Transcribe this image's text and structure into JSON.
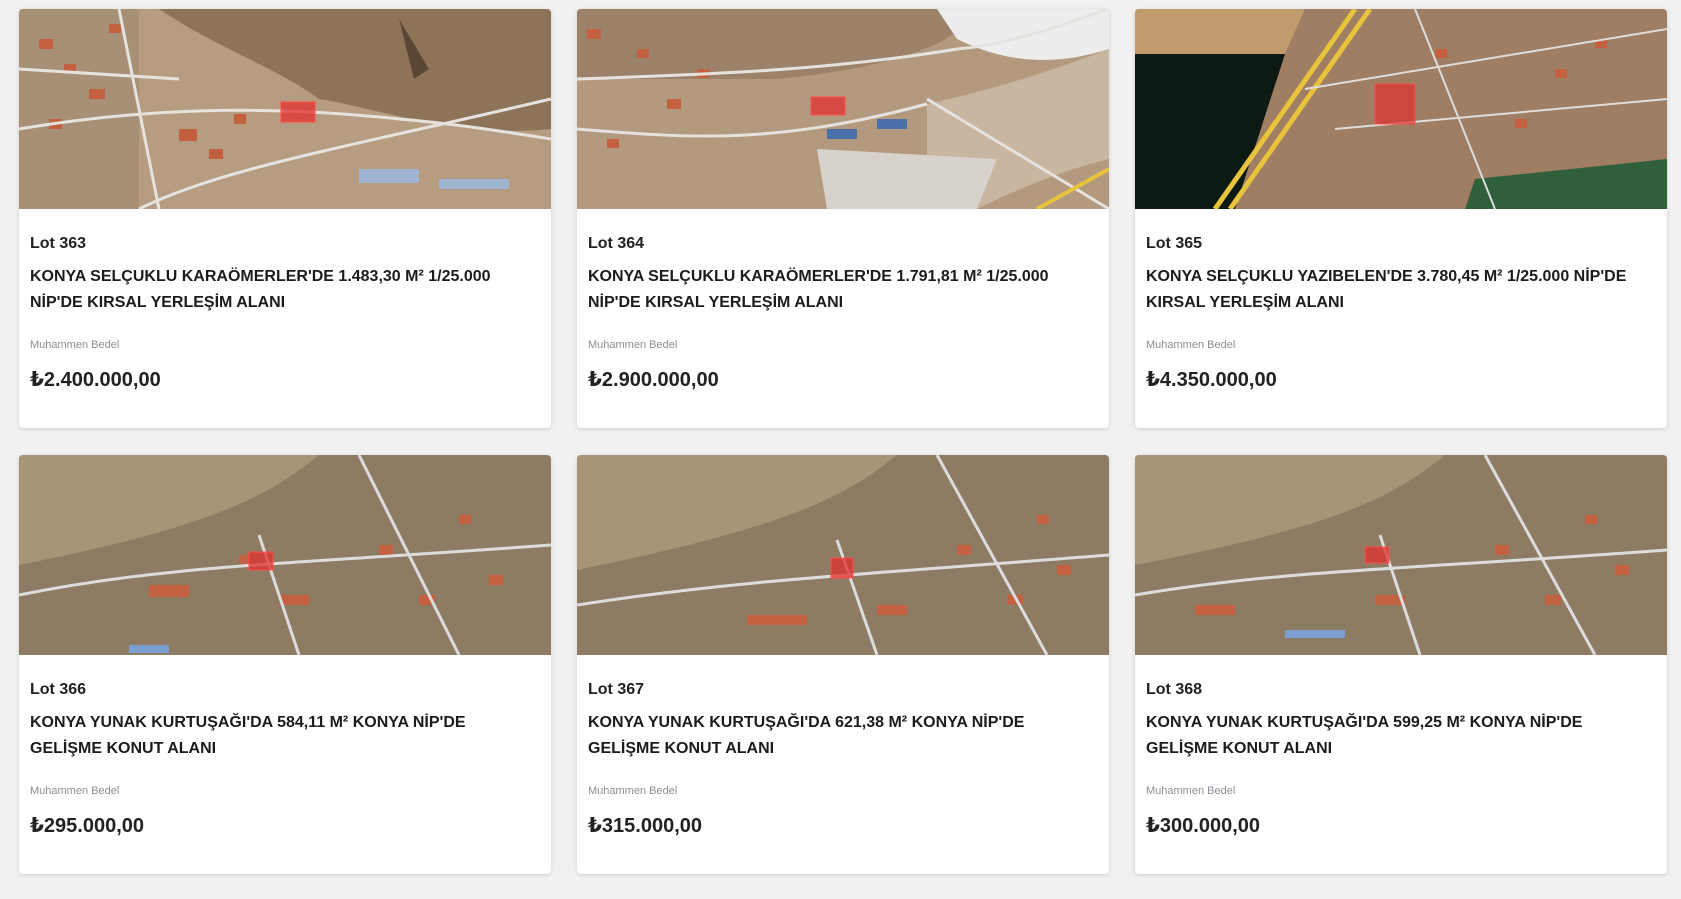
{
  "listings": [
    {
      "lot": "Lot 363",
      "title": "KONYA SELÇUKLU KARAÖMERLER'DE 1.483,30 M² 1/25.000 NİP'DE KIRSAL YERLEŞİM ALANI",
      "price_label": "Muhammen Bedel",
      "price": "₺2.400.000,00"
    },
    {
      "lot": "Lot 364",
      "title": "KONYA SELÇUKLU KARAÖMERLER'DE 1.791,81 M² 1/25.000 NİP'DE KIRSAL YERLEŞİM ALANI",
      "price_label": "Muhammen Bedel",
      "price": "₺2.900.000,00"
    },
    {
      "lot": "Lot 365",
      "title": "KONYA SELÇUKLU YAZIBELEN'DE 3.780,45 M² 1/25.000 NİP'DE KIRSAL YERLEŞİM ALANI",
      "price_label": "Muhammen Bedel",
      "price": "₺4.350.000,00"
    },
    {
      "lot": "Lot 366",
      "title": "KONYA YUNAK KURTUŞAĞI'DA 584,11 M² KONYA NİP'DE GELİŞME KONUT ALANI",
      "price_label": "Muhammen Bedel",
      "price": "₺295.000,00"
    },
    {
      "lot": "Lot 367",
      "title": "KONYA YUNAK KURTUŞAĞI'DA 621,38 M² KONYA NİP'DE GELİŞME KONUT ALANI",
      "price_label": "Muhammen Bedel",
      "price": "₺315.000,00"
    },
    {
      "lot": "Lot 368",
      "title": "KONYA YUNAK KURTUŞAĞI'DA 599,25 M² KONYA NİP'DE GELİŞME KONUT ALANI",
      "price_label": "Muhammen Bedel",
      "price": "₺300.000,00"
    }
  ],
  "colors": {
    "page_bg": "#f1f1f1",
    "terrain": "#a58a6e",
    "terrain_light": "#c9b8a3",
    "road": "#e3e3e3",
    "parcel": "#e0302d",
    "field_dark": "#0d1a14",
    "field_green": "#2f5f3b",
    "highway": "#e8c33c",
    "roof": "#c2603f"
  },
  "icons": [
    "satellite-map-image",
    "parcel-marker-icon"
  ]
}
